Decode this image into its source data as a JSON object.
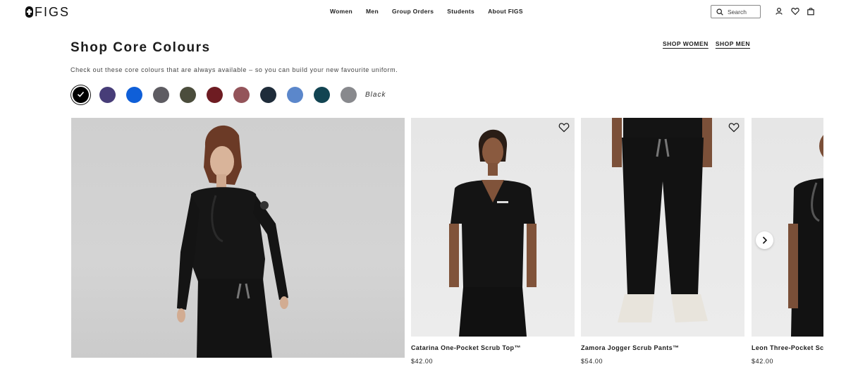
{
  "brand": {
    "logo_text": "FIGS"
  },
  "nav": {
    "items": [
      {
        "label": "Women"
      },
      {
        "label": "Men"
      },
      {
        "label": "Group Orders"
      },
      {
        "label": "Students"
      },
      {
        "label": "About FIGS"
      }
    ]
  },
  "search": {
    "placeholder": "Search"
  },
  "header_icons": [
    "account-icon",
    "wishlist-heart-icon",
    "cart-bag-icon"
  ],
  "main": {
    "title": "Shop Core Colours",
    "subtitle": "Check out these core colours that are always available – so you can build your new favourite uniform.",
    "shop_links": [
      {
        "label": "SHOP WOMEN"
      },
      {
        "label": "SHOP MEN"
      }
    ],
    "selected_colour": "Black",
    "swatches": [
      {
        "color": "#000000",
        "selected": true
      },
      {
        "color": "#473d78",
        "selected": false
      },
      {
        "color": "#0f5fd8",
        "selected": false
      },
      {
        "color": "#5e5c62",
        "selected": false
      },
      {
        "color": "#4b4d3c",
        "selected": false
      },
      {
        "color": "#6e1c22",
        "selected": false
      },
      {
        "color": "#94545a",
        "selected": false
      },
      {
        "color": "#1f2c3a",
        "selected": false
      },
      {
        "color": "#5b87cb",
        "selected": false
      },
      {
        "color": "#124452",
        "selected": false
      },
      {
        "color": "#88898d",
        "selected": false
      }
    ]
  },
  "products": [
    {
      "name": "Catarina One-Pocket Scrub Top™",
      "price": "$42.00"
    },
    {
      "name": "Zamora Jogger Scrub Pants™",
      "price": "$54.00"
    },
    {
      "name": "Leon Three-Pocket Scrub Top™",
      "price": "$42.00"
    }
  ]
}
